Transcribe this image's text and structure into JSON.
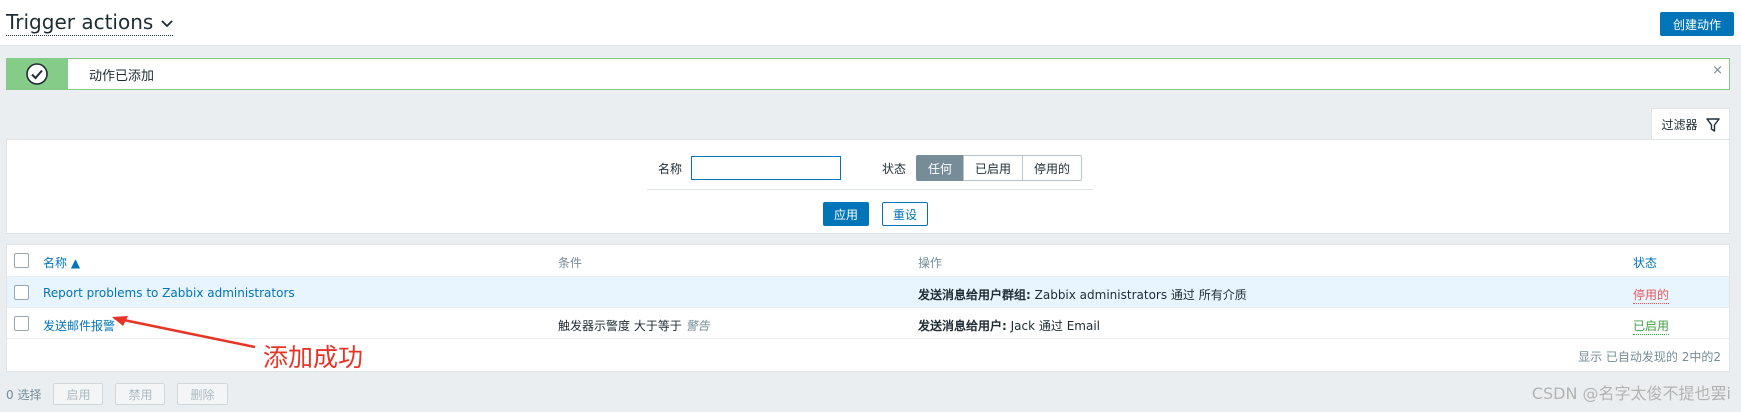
{
  "header": {
    "title": "Trigger actions",
    "create_button": "创建动作"
  },
  "message": {
    "text": "动作已添加",
    "close": "×"
  },
  "filter": {
    "tab_label": "过滤器",
    "name_label": "名称",
    "name_value": "",
    "status_label": "状态",
    "status_options": [
      "任何",
      "已启用",
      "停用的"
    ],
    "status_selected": "任何",
    "apply_button": "应用",
    "reset_button": "重设"
  },
  "table": {
    "columns": {
      "name": "名称 ▲",
      "conditions": "条件",
      "operations": "操作",
      "status": "状态"
    },
    "rows": [
      {
        "name": "Report problems to Zabbix administrators",
        "condition": "",
        "ops_bold": "发送消息给用户群组:",
        "ops_rest": " Zabbix administrators 通过 所有介质",
        "status": "停用的"
      },
      {
        "name": "发送邮件报警",
        "condition_prefix": "触发器示警度 大于等于 ",
        "condition_italic": "警告",
        "ops_bold": "发送消息给用户:",
        "ops_rest": " Jack 通过 Email",
        "status": "已启用"
      }
    ],
    "footer": "显示 已自动发现的 2中的2"
  },
  "bottom": {
    "selected": "0 选择",
    "enable": "启用",
    "disable": "禁用",
    "delete": "删除"
  },
  "annotation": {
    "text": "添加成功",
    "color": "#e63526"
  },
  "watermark": "CSDN @名字太俊不提也罢i",
  "colors": {
    "accent": "#0275b8",
    "success": "#86cc89",
    "enabled": "#429e47",
    "disabled": "#e45959"
  }
}
